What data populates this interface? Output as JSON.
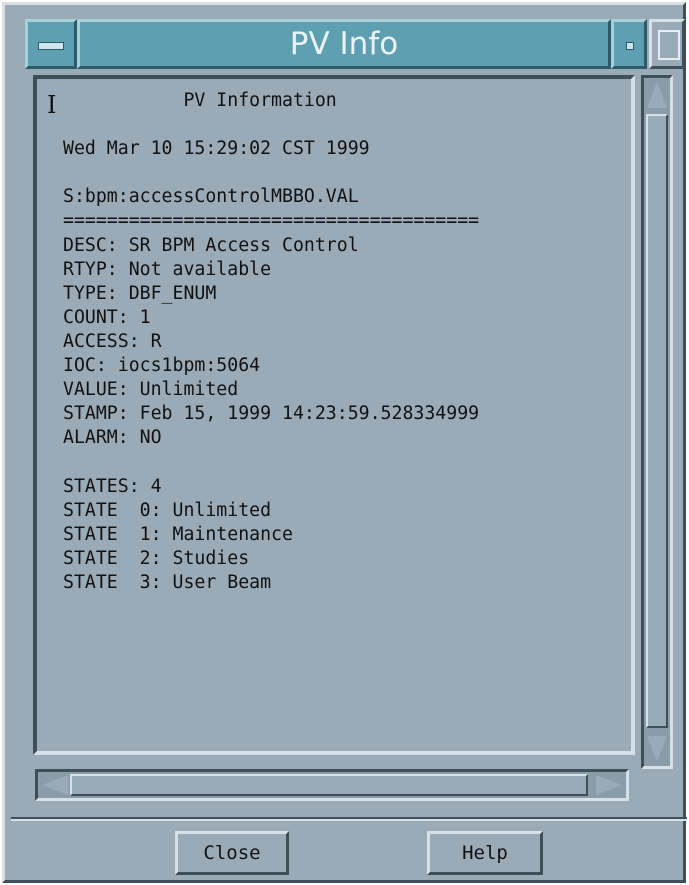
{
  "window": {
    "title": "PV Info"
  },
  "info": {
    "text": "           PV Information\n\nWed Mar 10 15:29:02 CST 1999\n\nS:bpm:accessControlMBBO.VAL\n======================================\nDESC: SR BPM Access Control\nRTYP: Not available\nTYPE: DBF_ENUM\nCOUNT: 1\nACCESS: R\nIOC: iocs1bpm:5064\nVALUE: Unlimited\nSTAMP: Feb 15, 1999 14:23:59.528334999\nALARM: NO\n\nSTATES: 4\nSTATE  0: Unlimited\nSTATE  1: Maintenance\nSTATE  2: Studies\nSTATE  3: User Beam"
  },
  "buttons": {
    "close": "Close",
    "help": "Help"
  },
  "icons": {
    "window_menu": "window-menu-icon",
    "minimize": "minimize-icon",
    "maximize": "maximize-icon",
    "text_cursor": "i-beam-cursor-icon"
  },
  "colors": {
    "background": "#9aabb7",
    "titlebar": "#5ea0b1",
    "title_text": "#e8f3f6"
  }
}
